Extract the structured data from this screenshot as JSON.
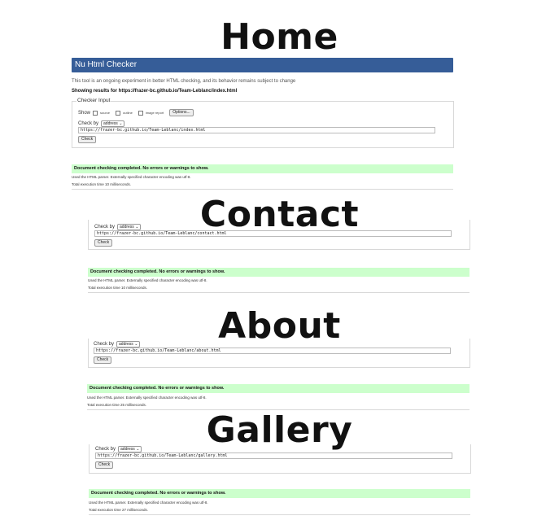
{
  "titles": {
    "home": "Home",
    "contact": "Contact",
    "about": "About",
    "gallery": "Gallery"
  },
  "checker": {
    "header": "Nu Html Checker",
    "intro": "This tool is an ongoing experiment in better HTML checking, and its behavior remains subject to change",
    "showing_prefix": "Showing results for ",
    "showing_url": "https://frazer-bc.github.io/Team-Leblanc/index.html",
    "legend": "Checker Input",
    "show_label": "Show",
    "opt_source": "source",
    "opt_outline": "outline",
    "opt_image": "image report",
    "options_button": "Options...",
    "check_by": "Check by",
    "select_value": "address",
    "check_button": "Check",
    "success_msg": "Document checking completed. No errors or warnings to show.",
    "parser_note": "Used the HTML parser. Externally specified character encoding was utf-8."
  },
  "pages": [
    {
      "key": "home",
      "url": "https://frazer-bc.github.io/Team-Leblanc/index.html",
      "time": "Total execution time 10 milliseconds."
    },
    {
      "key": "contact",
      "url": "https://frazer-bc.github.io/Team-Leblanc/contact.html",
      "time": "Total execution time 10 milliseconds."
    },
    {
      "key": "about",
      "url": "https://frazer-bc.github.io/Team-Leblanc/about.html",
      "time": "Total execution time 25 milliseconds."
    },
    {
      "key": "gallery",
      "url": "https://frazer-bc.github.io/Team-Leblanc/gallery.html",
      "time": "Total execution time 27 milliseconds."
    }
  ]
}
